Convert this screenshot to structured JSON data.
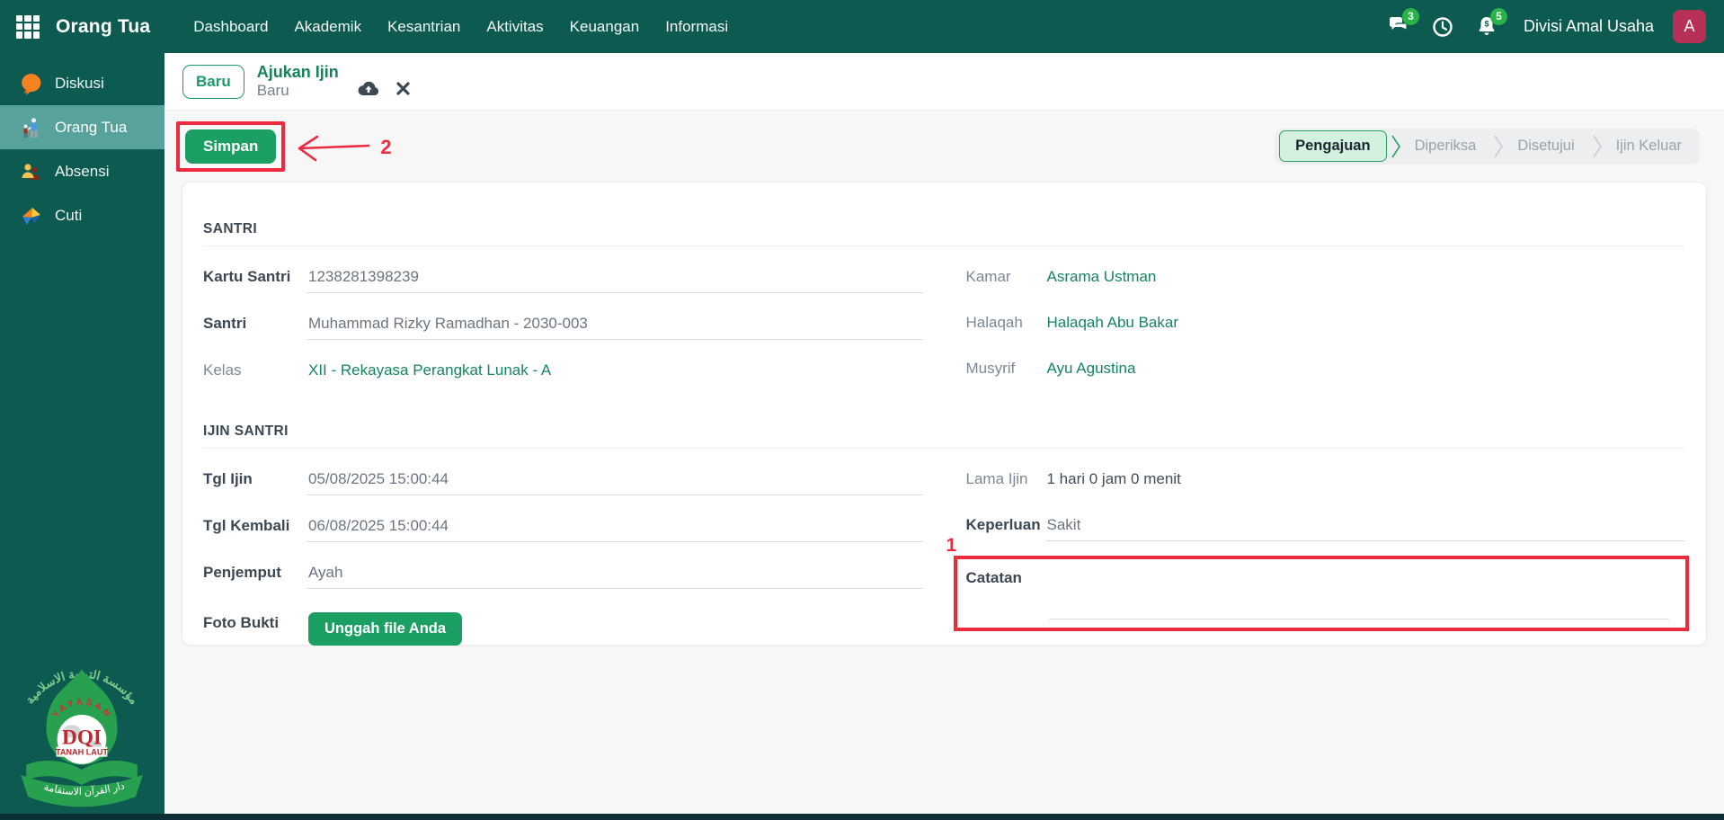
{
  "navbar": {
    "app_title": "Orang Tua",
    "menu": [
      {
        "label": "Dashboard"
      },
      {
        "label": "Akademik"
      },
      {
        "label": "Kesantrian"
      },
      {
        "label": "Aktivitas"
      },
      {
        "label": "Keuangan"
      },
      {
        "label": "Informasi"
      }
    ],
    "chat_badge": "3",
    "notification_badge": "5",
    "user_division": "Divisi Amal Usaha",
    "avatar_letter": "A"
  },
  "sidebar": {
    "items": [
      {
        "label": "Diskusi",
        "icon": "chat-bubble-icon"
      },
      {
        "label": "Orang Tua",
        "icon": "parent-child-icon"
      },
      {
        "label": "Absensi",
        "icon": "attendance-people-icon"
      },
      {
        "label": "Cuti",
        "icon": "leave-origami-icon"
      }
    ],
    "logo": {
      "arc_text_top": "مؤسسة التربية الاسلامية",
      "yayasan": "YAYASAN",
      "abbr": "DQI",
      "place": "TANAH LAUT",
      "ribbon_text": "دار القرآن الاستقامة"
    }
  },
  "page_head": {
    "status_badge": "Baru",
    "title": "Ajukan Ijin",
    "subtitle": "Baru"
  },
  "toolbar": {
    "save_label": "Simpan",
    "workflow_states": [
      {
        "label": "Pengajuan",
        "active": true
      },
      {
        "label": "Diperiksa",
        "active": false
      },
      {
        "label": "Disetujui",
        "active": false
      },
      {
        "label": "Ijin Keluar",
        "active": false
      }
    ]
  },
  "annotations": {
    "step_1": "1",
    "step_2": "2"
  },
  "form": {
    "santri_section": {
      "title": "SANTRI",
      "left": [
        {
          "label": "Kartu Santri",
          "value": "1238281398239",
          "type": "input"
        },
        {
          "label": "Santri",
          "value": "Muhammad Rizky Ramadhan - 2030-003",
          "type": "input"
        },
        {
          "label": "Kelas",
          "value": "XII - Rekayasa Perangkat Lunak - A",
          "type": "link"
        }
      ],
      "right": [
        {
          "label": "Kamar",
          "value": "Asrama Ustman",
          "type": "link"
        },
        {
          "label": "Halaqah",
          "value": "Halaqah Abu Bakar",
          "type": "link"
        },
        {
          "label": "Musyrif",
          "value": "Ayu Agustina",
          "type": "link"
        }
      ]
    },
    "ijin_section": {
      "title": "IJIN SANTRI",
      "left": [
        {
          "label": "Tgl Ijin",
          "value": "05/08/2025 15:00:44",
          "type": "input"
        },
        {
          "label": "Tgl Kembali",
          "value": "06/08/2025 15:00:44",
          "type": "input"
        },
        {
          "label": "Penjemput",
          "value": "Ayah",
          "type": "input"
        }
      ],
      "upload_field": {
        "label": "Foto Bukti",
        "button_label": "Unggah file Anda"
      },
      "right": [
        {
          "label": "Lama Ijin",
          "value": "1 hari 0 jam 0 menit",
          "type": "readonly"
        },
        {
          "label": "Keperluan",
          "value": "Sakit",
          "type": "input"
        }
      ],
      "notes_field": {
        "label": "Catatan",
        "value": ""
      }
    }
  },
  "icons": {
    "navbar": [
      "app-grid-icon",
      "chat-icon",
      "clock-icon",
      "notification-bell-icon"
    ],
    "page_head": [
      "cloud-upload-icon",
      "close-icon"
    ],
    "colors": {
      "teal_dark": "#0d5a51",
      "teal_active": "#57a29a",
      "green_primary": "#1c9f62",
      "green_link": "#17855e",
      "badge_green": "#2bb34b",
      "avatar_red": "#b73156",
      "annotation_red": "#ee2b3e",
      "workflow_active_bg": "#d3f1de"
    }
  }
}
